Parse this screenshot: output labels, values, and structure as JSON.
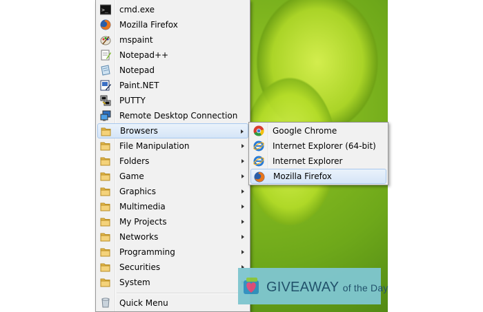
{
  "menu": {
    "items": [
      {
        "label": "cmd.exe",
        "icon": "cmd-icon"
      },
      {
        "label": "Mozilla Firefox",
        "icon": "firefox-icon"
      },
      {
        "label": "mspaint",
        "icon": "paint-icon"
      },
      {
        "label": "Notepad++",
        "icon": "notepadpp-icon"
      },
      {
        "label": "Notepad",
        "icon": "notepad-icon"
      },
      {
        "label": "Paint.NET",
        "icon": "paintnet-icon"
      },
      {
        "label": "PUTTY",
        "icon": "putty-icon"
      },
      {
        "label": "Remote Desktop Connection",
        "icon": "remote-desktop-icon"
      },
      {
        "label": "Browsers",
        "icon": "folder-icon"
      },
      {
        "label": "File Manipulation",
        "icon": "folder-icon"
      },
      {
        "label": "Folders",
        "icon": "folder-icon"
      },
      {
        "label": "Game",
        "icon": "folder-icon"
      },
      {
        "label": "Graphics",
        "icon": "folder-icon"
      },
      {
        "label": "Multimedia",
        "icon": "folder-icon"
      },
      {
        "label": "My Projects",
        "icon": "folder-icon"
      },
      {
        "label": "Networks",
        "icon": "folder-icon"
      },
      {
        "label": "Programming",
        "icon": "folder-icon"
      },
      {
        "label": "Securities",
        "icon": "folder-icon"
      },
      {
        "label": "System",
        "icon": "folder-icon"
      },
      {
        "label": "Quick Menu",
        "icon": "quick-menu-icon"
      }
    ]
  },
  "submenu": {
    "items": [
      {
        "label": "Google Chrome",
        "icon": "chrome-icon"
      },
      {
        "label": "Internet Explorer (64-bit)",
        "icon": "ie-icon"
      },
      {
        "label": "Internet Explorer",
        "icon": "ie-icon"
      },
      {
        "label": "Mozilla Firefox",
        "icon": "firefox-icon"
      }
    ]
  },
  "watermark": {
    "brand": "GIVEAWAY",
    "tagline": "of the Day"
  },
  "colors": {
    "highlight": "#d5e5f7",
    "menu_bg": "#f1f1f1",
    "watermark_bg": "#7fc6cf"
  }
}
